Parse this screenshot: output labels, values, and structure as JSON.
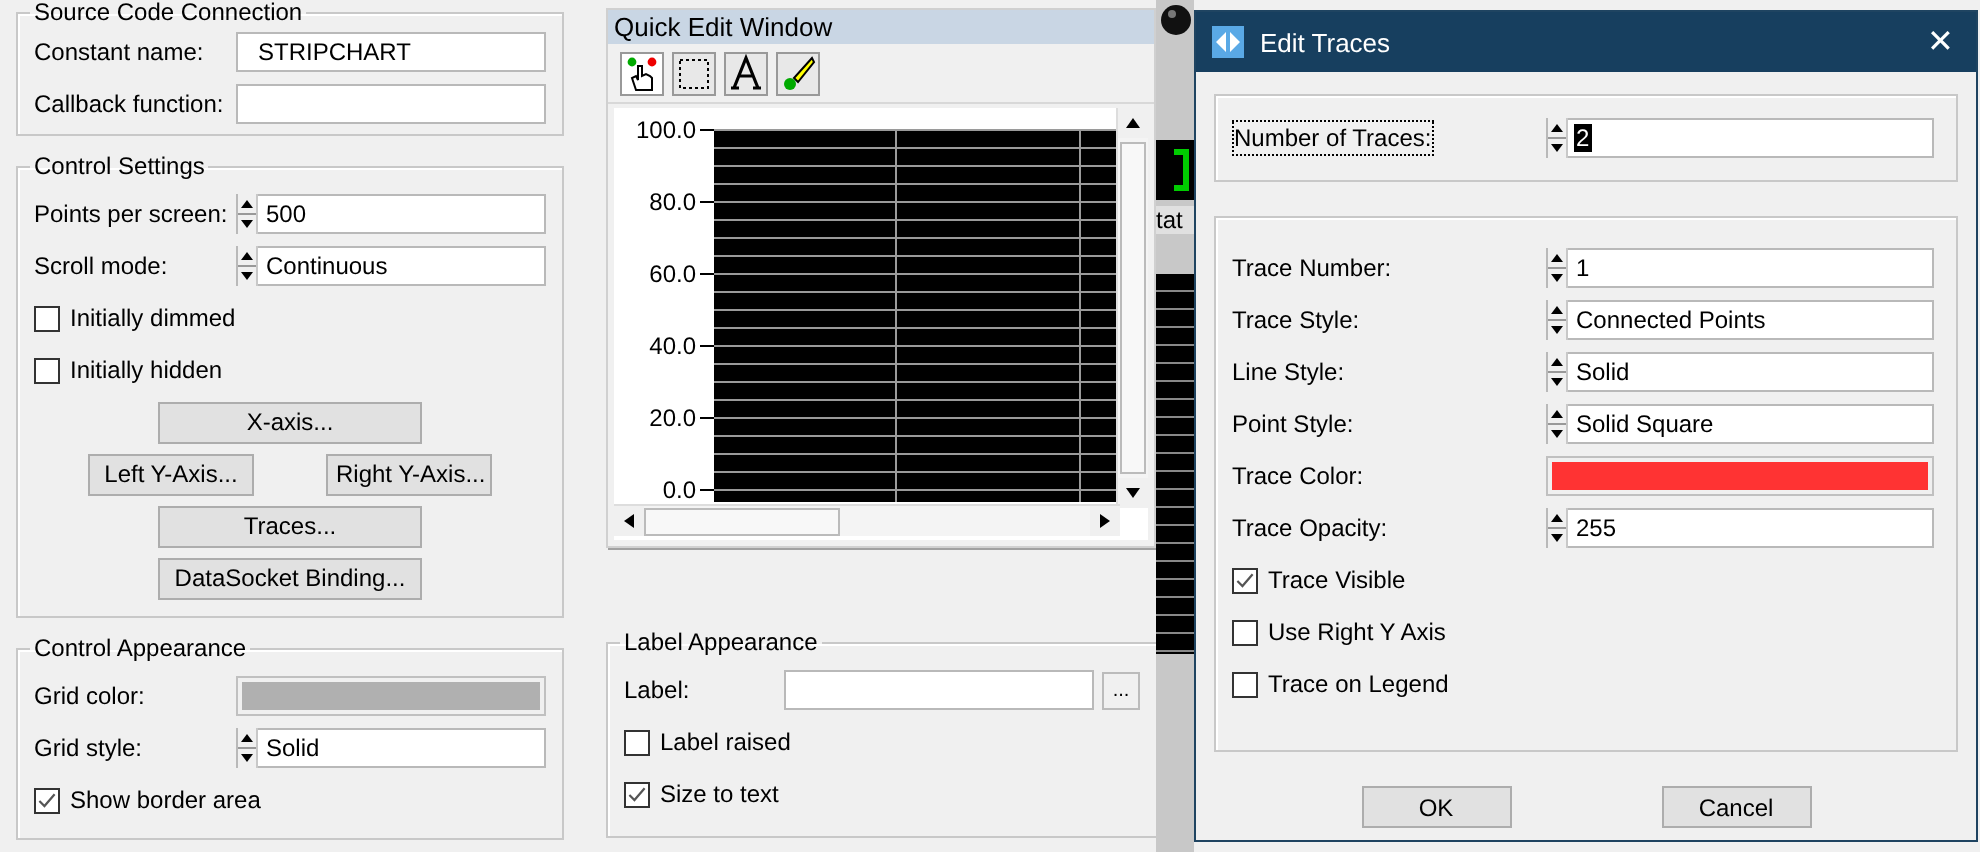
{
  "left_groups": [
    {
      "title": "Source Code Connection",
      "rows": [
        {
          "kind": "text",
          "label": "Constant name:",
          "value": "STRIPCHART"
        },
        {
          "kind": "text",
          "label": "Callback function:"
        }
      ]
    },
    {
      "title": "Control Settings",
      "rows": [
        {
          "kind": "spin",
          "label": "Points per screen:",
          "value": "500"
        },
        {
          "kind": "spin",
          "label": "Scroll mode:",
          "value": "Continuous"
        },
        {
          "kind": "checkbox",
          "label": "Initially dimmed",
          "checked": false
        },
        {
          "kind": "checkbox",
          "label": "Initially hidden",
          "checked": false
        },
        {
          "kind": "buttons",
          "buttons": [
            "X-axis..."
          ]
        },
        {
          "kind": "buttons",
          "buttons": [
            "Left Y-Axis...",
            "Right Y-Axis..."
          ]
        },
        {
          "kind": "buttons",
          "buttons": [
            "Traces..."
          ]
        },
        {
          "kind": "buttons",
          "buttons": [
            "DataSocket Binding..."
          ]
        }
      ]
    },
    {
      "title": "Control Appearance",
      "rows": [
        {
          "kind": "color",
          "label": "Grid color:",
          "color": "#b0b0b0"
        },
        {
          "kind": "spin",
          "label": "Grid style:",
          "value": "Solid"
        },
        {
          "kind": "checkbox",
          "label": "Show border area",
          "checked": true
        }
      ]
    }
  ],
  "quick_edit": {
    "title": "Quick Edit Window",
    "y_labels": [
      "100.0",
      "80.0",
      "60.0",
      "40.0",
      "20.0",
      "0.0"
    ]
  },
  "label_groups": [
    {
      "title": "Label Appearance",
      "rows": [
        {
          "kind": "browse",
          "label": "Label:",
          "button": "..."
        },
        {
          "kind": "checkbox",
          "label": "Label raised",
          "checked": false
        },
        {
          "kind": "checkbox",
          "label": "Size to text",
          "checked": true
        }
      ]
    }
  ],
  "background_fragment": "tat",
  "dialog": {
    "title": "Edit Traces",
    "close": "✕",
    "groups": [
      {
        "rows": [
          {
            "kind": "spin",
            "label": "Number of Traces:",
            "value": "2",
            "focused": true
          }
        ]
      },
      {
        "rows": [
          {
            "kind": "spin",
            "label": "Trace Number:",
            "value": "1"
          },
          {
            "kind": "spin",
            "label": "Trace Style:",
            "value": "Connected Points"
          },
          {
            "kind": "spin",
            "label": "Line Style:",
            "value": "Solid"
          },
          {
            "kind": "spin",
            "label": "Point Style:",
            "value": "Solid Square"
          },
          {
            "kind": "color",
            "label": "Trace Color:",
            "color": "#ff3333"
          },
          {
            "kind": "spin",
            "label": "Trace Opacity:",
            "value": "255"
          },
          {
            "kind": "checkbox",
            "label": "Trace Visible",
            "checked": true
          },
          {
            "kind": "checkbox",
            "label": "Use Right Y Axis",
            "checked": false
          },
          {
            "kind": "checkbox",
            "label": "Trace on Legend",
            "checked": false
          }
        ]
      }
    ],
    "buttons": [
      "OK",
      "Cancel"
    ]
  }
}
